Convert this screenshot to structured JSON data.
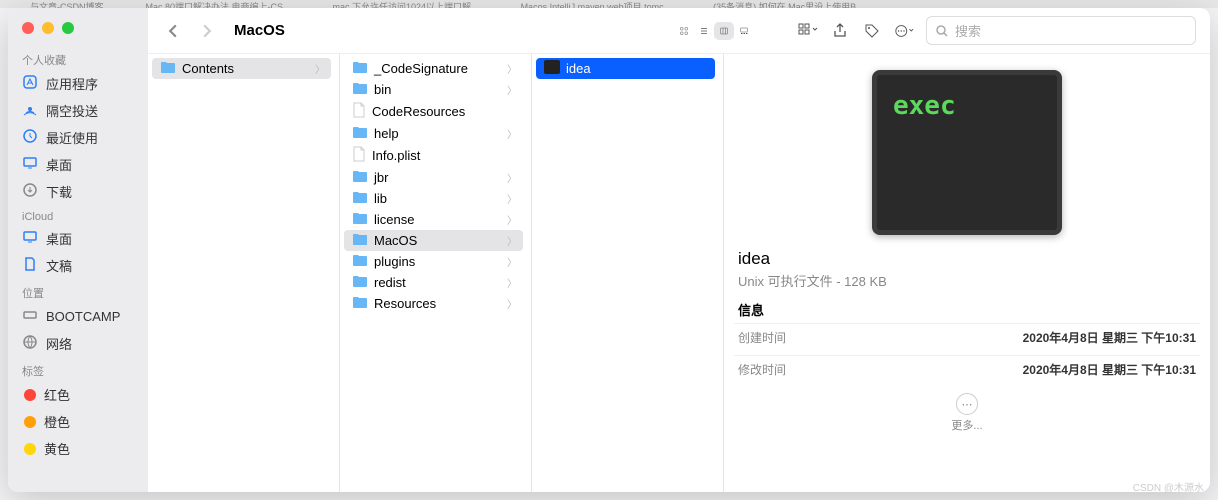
{
  "browser_tabs": [
    "与文章-CSDN博客",
    "Mac 80端口解决办法 电商编上-CS...",
    "mac 下允许任访问1024以上端口解...",
    "Macos IntelliJ maven web项目 tomc...",
    "(35条消息) 如何在 Mac里设上使用B..."
  ],
  "toolbar": {
    "title": "MacOS",
    "search_placeholder": "搜索"
  },
  "sidebar": {
    "sections": [
      {
        "label": "个人收藏",
        "items": [
          {
            "icon": "app",
            "label": "应用程序"
          },
          {
            "icon": "airdrop",
            "label": "隔空投送"
          },
          {
            "icon": "clock",
            "label": "最近使用"
          },
          {
            "icon": "desktop",
            "label": "桌面"
          },
          {
            "icon": "download",
            "label": "下载"
          }
        ]
      },
      {
        "label": "iCloud",
        "items": [
          {
            "icon": "desktop",
            "label": "桌面"
          },
          {
            "icon": "doc",
            "label": "文稿"
          }
        ]
      },
      {
        "label": "位置",
        "items": [
          {
            "icon": "disk",
            "label": "BOOTCAMP"
          },
          {
            "icon": "globe",
            "label": "网络"
          }
        ]
      },
      {
        "label": "标签",
        "items": [
          {
            "color": "#ff453a",
            "label": "红色"
          },
          {
            "color": "#ff9f0a",
            "label": "橙色"
          },
          {
            "color": "#ffd60a",
            "label": "黄色"
          }
        ]
      }
    ]
  },
  "col1": [
    {
      "name": "Contents",
      "type": "folder",
      "selected": true
    }
  ],
  "col2": [
    {
      "name": "_CodeSignature",
      "type": "folder"
    },
    {
      "name": "bin",
      "type": "folder"
    },
    {
      "name": "CodeResources",
      "type": "file"
    },
    {
      "name": "help",
      "type": "folder"
    },
    {
      "name": "Info.plist",
      "type": "file"
    },
    {
      "name": "jbr",
      "type": "folder"
    },
    {
      "name": "lib",
      "type": "folder"
    },
    {
      "name": "license",
      "type": "folder"
    },
    {
      "name": "MacOS",
      "type": "folder",
      "selected": true
    },
    {
      "name": "plugins",
      "type": "folder"
    },
    {
      "name": "redist",
      "type": "folder"
    },
    {
      "name": "Resources",
      "type": "folder"
    }
  ],
  "col3": [
    {
      "name": "idea",
      "type": "exec",
      "selected": true
    }
  ],
  "preview": {
    "exec_label": "exec",
    "name": "idea",
    "subtitle": "Unix 可执行文件 - 128 KB",
    "info_header": "信息",
    "rows": [
      {
        "k": "创建时间",
        "v": "2020年4月8日 星期三 下午10:31"
      },
      {
        "k": "修改时间",
        "v": "2020年4月8日 星期三 下午10:31"
      }
    ],
    "more": "更多..."
  },
  "watermark": "CSDN @木源水"
}
